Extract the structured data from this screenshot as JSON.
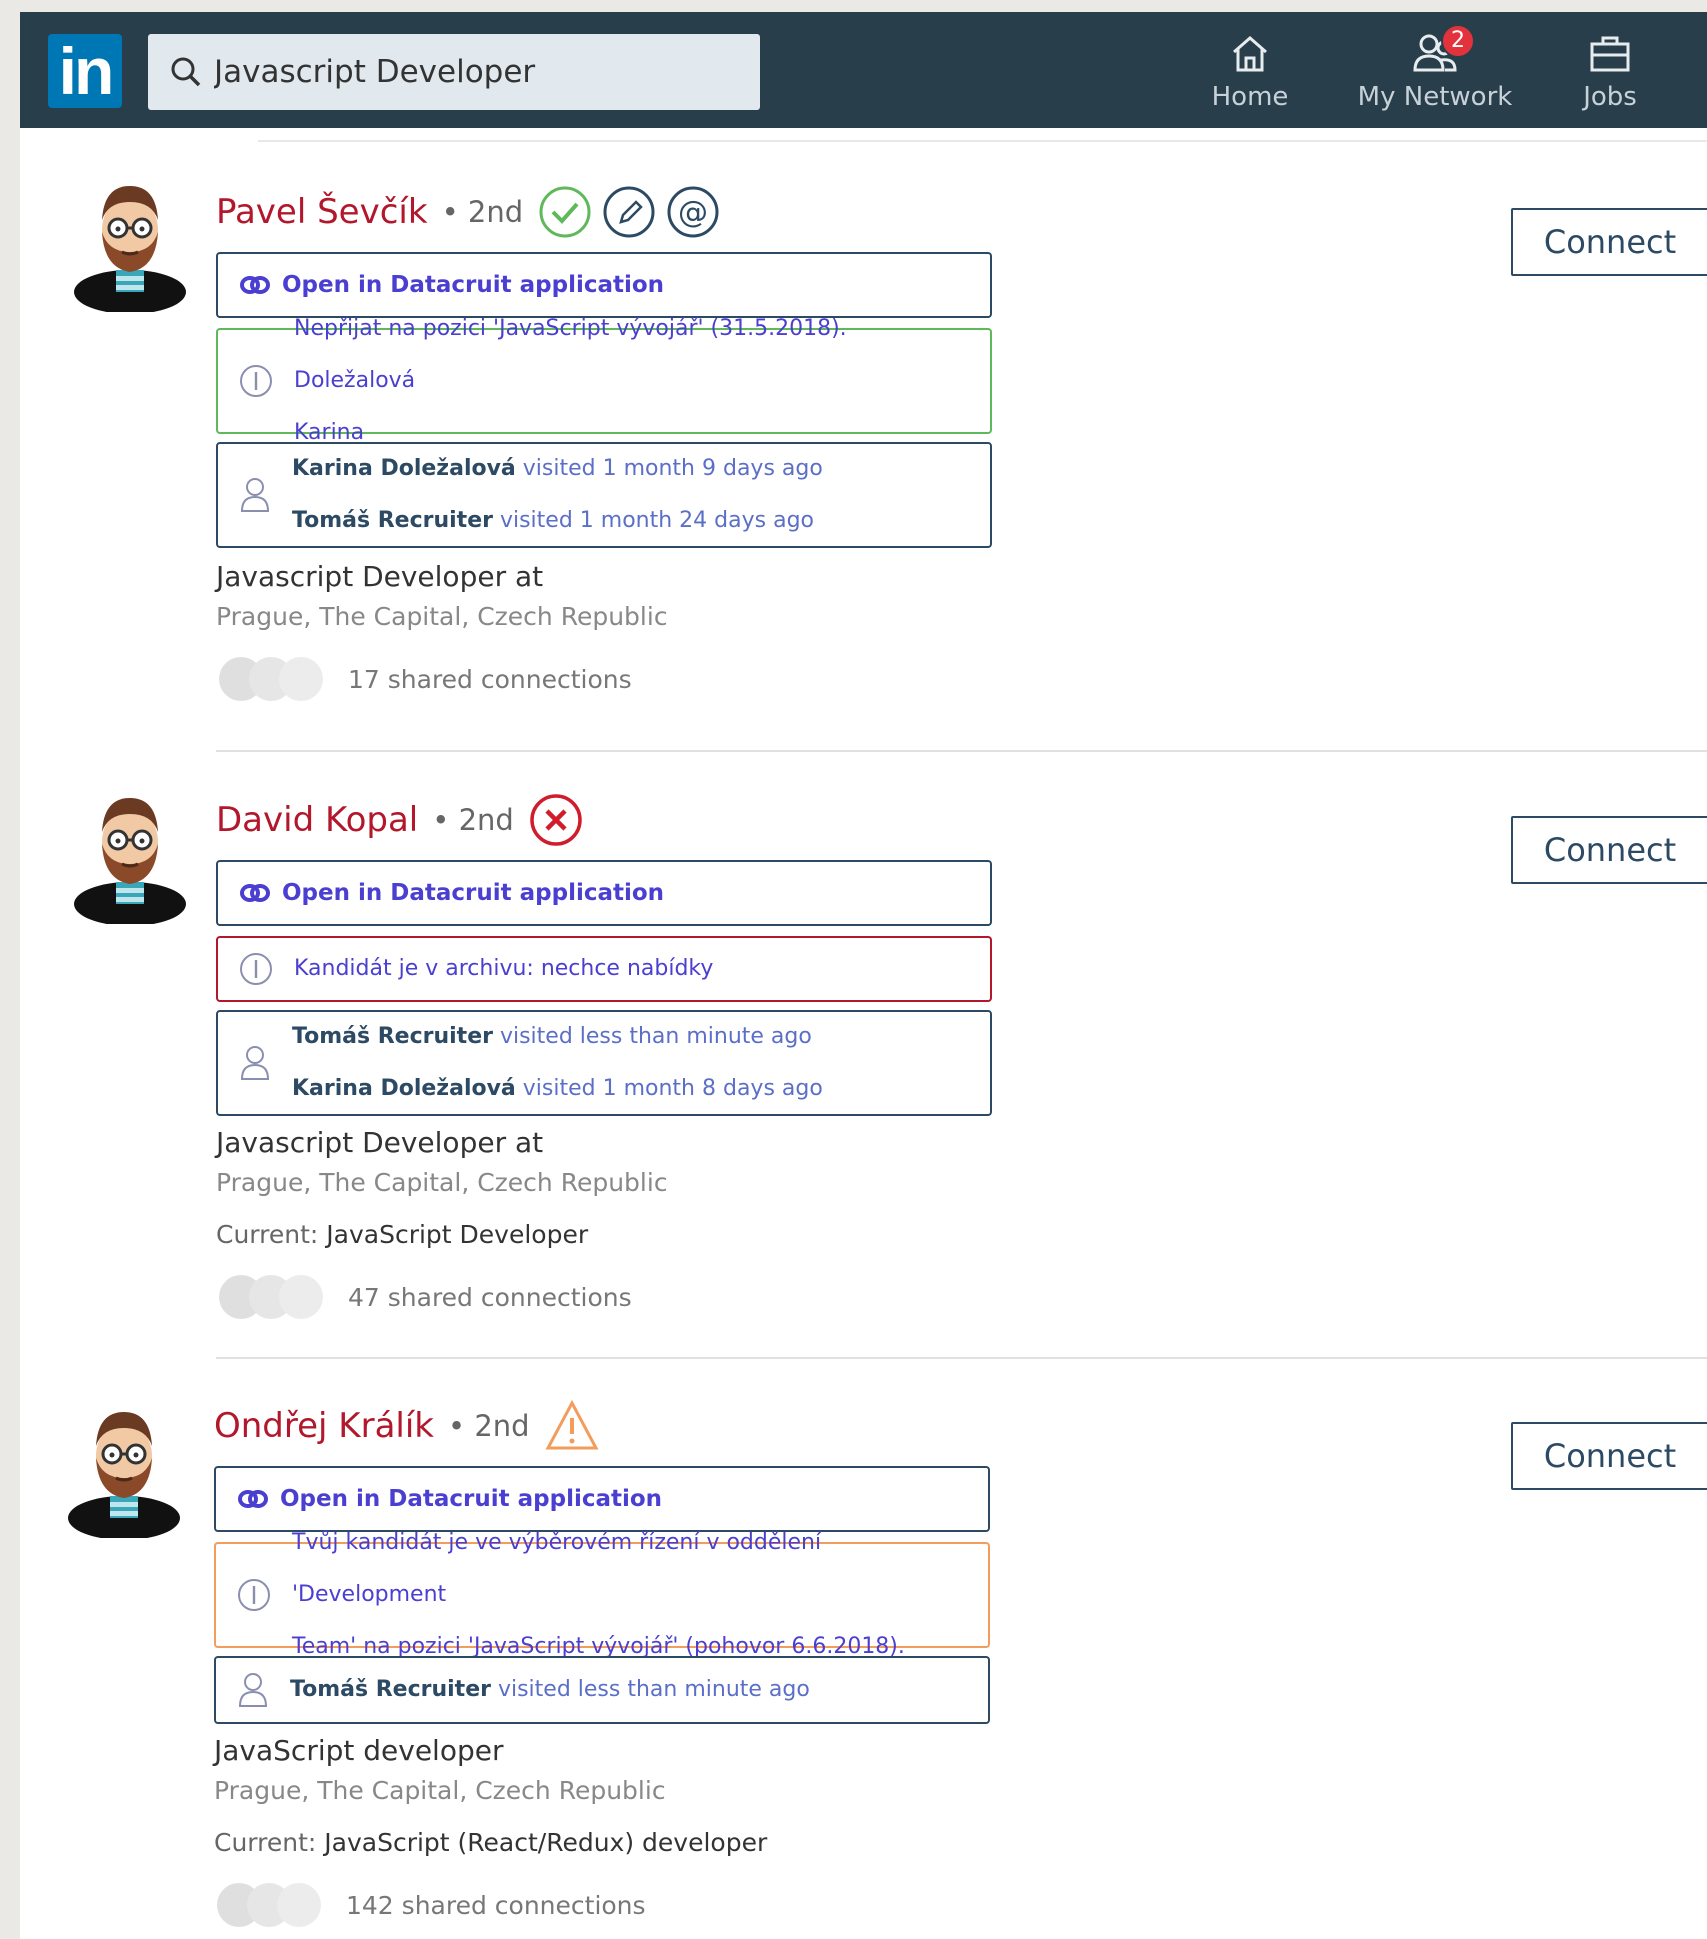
{
  "nav": {
    "logo": "in",
    "search_value": "Javascript Developer",
    "items": [
      {
        "label": "Home",
        "icon": "home-icon"
      },
      {
        "label": "My Network",
        "icon": "network-icon",
        "badge": "2"
      },
      {
        "label": "Jobs",
        "icon": "briefcase-icon"
      }
    ]
  },
  "colors": {
    "nav_bg": "#283e4a",
    "name": "#b2172c",
    "link": "#4a3fd0",
    "ok": "#5fb85a",
    "error": "#b2172c",
    "warning": "#f39c5b"
  },
  "results": [
    {
      "name": "Pavel Ševčík",
      "degree": "• 2nd",
      "status_icons": [
        "check-circle-icon",
        "pencil-circle-icon",
        "at-circle-icon"
      ],
      "open_label": "Open in Datacruit application",
      "note_lines": [
        "Nepřijat na pozici 'JavaScript vývojář' (31.5.2018). Doležalová",
        "Karina"
      ],
      "visits": [
        {
          "name": "Karina Doležalová",
          "text": " visited 1 month 9 days ago"
        },
        {
          "name": "Tomáš Recruiter",
          "text": " visited 1 month 24 days ago"
        }
      ],
      "headline": "Javascript Developer at",
      "location": "Prague, The Capital, Czech Republic",
      "shared": "17 shared connections",
      "connect_label": "Connect"
    },
    {
      "name": "David Kopal",
      "degree": "• 2nd",
      "status_icons": [
        "x-circle-icon"
      ],
      "open_label": "Open in Datacruit application",
      "note_lines": [
        "Kandidát je v archivu: nechce nabídky"
      ],
      "visits": [
        {
          "name": "Tomáš Recruiter",
          "text": " visited less than minute ago"
        },
        {
          "name": "Karina Doležalová",
          "text": " visited 1 month 8 days ago"
        }
      ],
      "headline": "Javascript Developer at",
      "location": "Prague, The Capital, Czech Republic",
      "current_label": "Current:",
      "current_value": " JavaScript Developer",
      "shared": "47 shared connections",
      "connect_label": "Connect"
    },
    {
      "name": "Ondřej Králík",
      "degree": "• 2nd",
      "status_icons": [
        "warning-triangle-icon"
      ],
      "open_label": "Open in Datacruit application",
      "note_lines": [
        "Tvůj kandidát je ve výběrovém řízení v oddělení 'Development",
        "Team' na pozici 'JavaScript vývojář' (pohovor 6.6.2018)."
      ],
      "visits": [
        {
          "name": "Tomáš Recruiter",
          "text": " visited less than minute ago"
        }
      ],
      "headline": "JavaScript developer",
      "location": "Prague, The Capital, Czech Republic",
      "current_label": "Current:",
      "current_value": " JavaScript (React/Redux) developer",
      "shared": "142 shared connections",
      "connect_label": "Connect"
    }
  ]
}
